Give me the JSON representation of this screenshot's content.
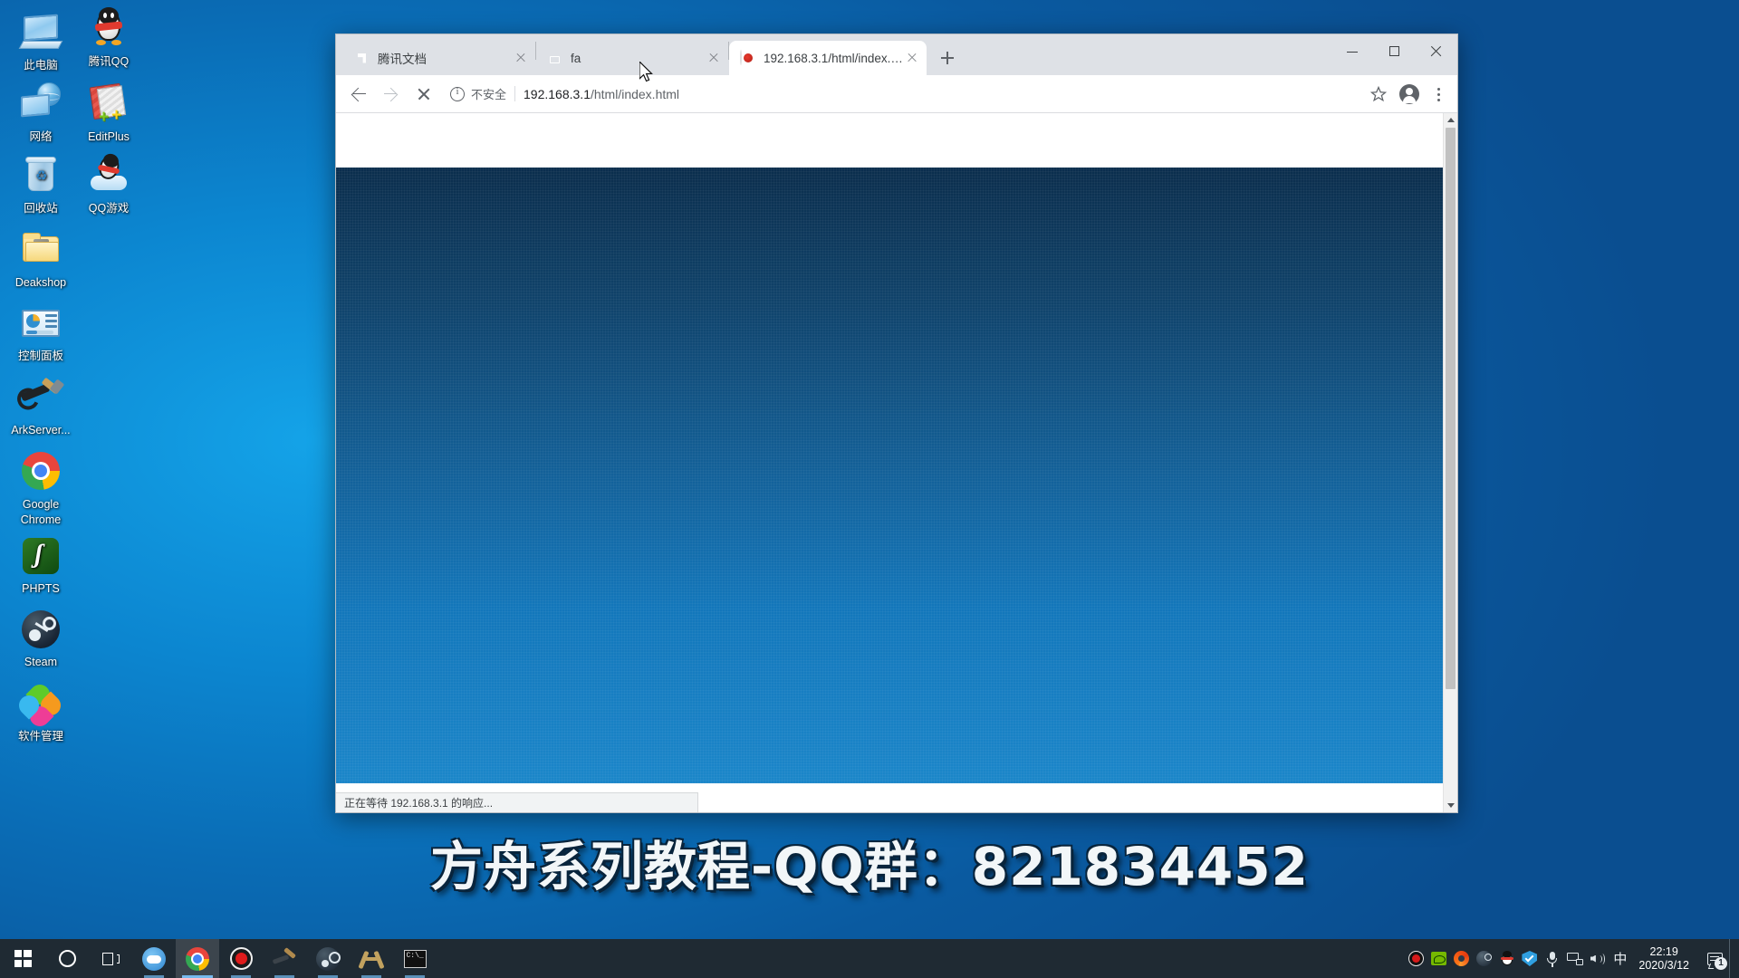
{
  "desktop": {
    "icons": [
      {
        "label": "此电脑",
        "icon": "this-pc-icon"
      },
      {
        "label": "腾讯QQ",
        "icon": "tencent-qq-icon"
      },
      {
        "label": "网络",
        "icon": "network-icon"
      },
      {
        "label": "EditPlus",
        "icon": "editplus-icon"
      },
      {
        "label": "回收站",
        "icon": "recycle-bin-icon"
      },
      {
        "label": "QQ游戏",
        "icon": "qq-games-icon"
      },
      {
        "label": "Deakshop",
        "icon": "folder-icon"
      },
      {
        "label": "控制面板",
        "icon": "control-panel-icon"
      },
      {
        "label": "ArkServer...",
        "icon": "ark-server-tools-icon"
      },
      {
        "label": "Google Chrome",
        "icon": "chrome-icon"
      },
      {
        "label": "PHPTS",
        "icon": "phpts-icon"
      },
      {
        "label": "Steam",
        "icon": "steam-icon"
      },
      {
        "label": "软件管理",
        "icon": "software-manager-icon"
      }
    ]
  },
  "caption": {
    "text": "方舟系列教程-QQ群：821834452"
  },
  "browser": {
    "tabs": [
      {
        "title": "腾讯文档",
        "favicon": "tencent-docs-favicon",
        "active": false
      },
      {
        "title": "fa",
        "favicon": "file-favicon",
        "active": false
      },
      {
        "title": "192.168.3.1/html/index.html",
        "favicon": "router-favicon",
        "active": true
      }
    ],
    "new_tab_label": "+",
    "window_controls": {
      "minimize": "minimize-button",
      "maximize": "maximize-button",
      "close": "close-button"
    },
    "toolbar": {
      "back": "back-button",
      "forward": "forward-button",
      "stop": "stop-loading-button",
      "security_label": "不安全",
      "url_domain": "192.168.3.1",
      "url_path": "/html/index.html",
      "bookmark": "bookmark-star-button",
      "profile": "profile-avatar-button",
      "menu": "chrome-menu-button"
    },
    "status_text": "正在等待 192.168.3.1 的响应...",
    "page": {
      "background_top": "#0b2e4d",
      "background_bottom": "#1b86c9"
    }
  },
  "taskbar": {
    "items": [
      {
        "name": "start-button",
        "icon": "windows-logo-icon"
      },
      {
        "name": "cortana-search-button",
        "icon": "circle-icon"
      },
      {
        "name": "task-view-button",
        "icon": "task-view-icon"
      },
      {
        "name": "taskbar-game-app",
        "icon": "game-controller-icon"
      },
      {
        "name": "taskbar-chrome",
        "icon": "chrome-icon"
      },
      {
        "name": "taskbar-recorder",
        "icon": "record-icon"
      },
      {
        "name": "taskbar-ark-tools",
        "icon": "wrench-hammer-icon"
      },
      {
        "name": "taskbar-steam",
        "icon": "steam-icon"
      },
      {
        "name": "taskbar-ark",
        "icon": "ark-logo-icon"
      },
      {
        "name": "taskbar-terminal",
        "icon": "terminal-icon"
      }
    ],
    "tray": [
      {
        "name": "tray-recorder",
        "icon": "record-icon"
      },
      {
        "name": "tray-nvidia",
        "icon": "nvidia-icon"
      },
      {
        "name": "tray-browser",
        "icon": "browser-icon"
      },
      {
        "name": "tray-steam",
        "icon": "steam-icon"
      },
      {
        "name": "tray-qq",
        "icon": "qq-penguin-icon"
      },
      {
        "name": "tray-security",
        "icon": "shield-icon"
      },
      {
        "name": "tray-microphone",
        "icon": "microphone-icon"
      },
      {
        "name": "tray-network",
        "icon": "network-icon"
      },
      {
        "name": "tray-volume",
        "icon": "volume-icon"
      },
      {
        "name": "tray-ime",
        "icon": "ime-chinese-icon"
      }
    ],
    "ime_label": "中",
    "clock": {
      "time": "22:19",
      "date": "2020/3/12"
    },
    "notification_count": "1"
  }
}
